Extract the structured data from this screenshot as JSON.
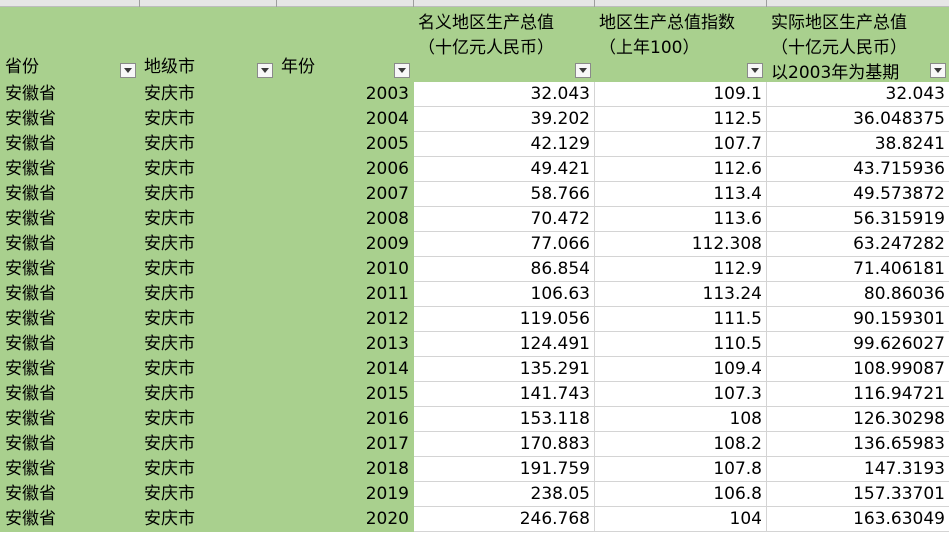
{
  "headers": {
    "province": "省份",
    "city": "地级市",
    "year": "年份",
    "nominal_gdp": "名义地区生产总值\n（十亿元人民币）",
    "gdp_index": "地区生产总值指数\n（上年100）",
    "real_gdp": "实际地区生产总值\n（十亿元人民币）\n以2003年为基期"
  },
  "rows": [
    {
      "province": "安徽省",
      "city": "安庆市",
      "year": "2003",
      "nominal": "32.043",
      "index": "109.1",
      "real": "32.043"
    },
    {
      "province": "安徽省",
      "city": "安庆市",
      "year": "2004",
      "nominal": "39.202",
      "index": "112.5",
      "real": "36.048375"
    },
    {
      "province": "安徽省",
      "city": "安庆市",
      "year": "2005",
      "nominal": "42.129",
      "index": "107.7",
      "real": "38.8241"
    },
    {
      "province": "安徽省",
      "city": "安庆市",
      "year": "2006",
      "nominal": "49.421",
      "index": "112.6",
      "real": "43.715936"
    },
    {
      "province": "安徽省",
      "city": "安庆市",
      "year": "2007",
      "nominal": "58.766",
      "index": "113.4",
      "real": "49.573872"
    },
    {
      "province": "安徽省",
      "city": "安庆市",
      "year": "2008",
      "nominal": "70.472",
      "index": "113.6",
      "real": "56.315919"
    },
    {
      "province": "安徽省",
      "city": "安庆市",
      "year": "2009",
      "nominal": "77.066",
      "index": "112.308",
      "real": "63.247282"
    },
    {
      "province": "安徽省",
      "city": "安庆市",
      "year": "2010",
      "nominal": "86.854",
      "index": "112.9",
      "real": "71.406181"
    },
    {
      "province": "安徽省",
      "city": "安庆市",
      "year": "2011",
      "nominal": "106.63",
      "index": "113.24",
      "real": "80.86036"
    },
    {
      "province": "安徽省",
      "city": "安庆市",
      "year": "2012",
      "nominal": "119.056",
      "index": "111.5",
      "real": "90.159301"
    },
    {
      "province": "安徽省",
      "city": "安庆市",
      "year": "2013",
      "nominal": "124.491",
      "index": "110.5",
      "real": "99.626027"
    },
    {
      "province": "安徽省",
      "city": "安庆市",
      "year": "2014",
      "nominal": "135.291",
      "index": "109.4",
      "real": "108.99087"
    },
    {
      "province": "安徽省",
      "city": "安庆市",
      "year": "2015",
      "nominal": "141.743",
      "index": "107.3",
      "real": "116.94721"
    },
    {
      "province": "安徽省",
      "city": "安庆市",
      "year": "2016",
      "nominal": "153.118",
      "index": "108",
      "real": "126.30298"
    },
    {
      "province": "安徽省",
      "city": "安庆市",
      "year": "2017",
      "nominal": "170.883",
      "index": "108.2",
      "real": "136.65983"
    },
    {
      "province": "安徽省",
      "city": "安庆市",
      "year": "2018",
      "nominal": "191.759",
      "index": "107.8",
      "real": "147.3193"
    },
    {
      "province": "安徽省",
      "city": "安庆市",
      "year": "2019",
      "nominal": "238.05",
      "index": "106.8",
      "real": "157.33701"
    },
    {
      "province": "安徽省",
      "city": "安庆市",
      "year": "2020",
      "nominal": "246.768",
      "index": "104",
      "real": "163.63049"
    }
  ],
  "colors": {
    "header_green": "#a9d08e",
    "grid_line": "#d4d4d4"
  },
  "icons": {
    "filter": "filter-dropdown-icon"
  }
}
